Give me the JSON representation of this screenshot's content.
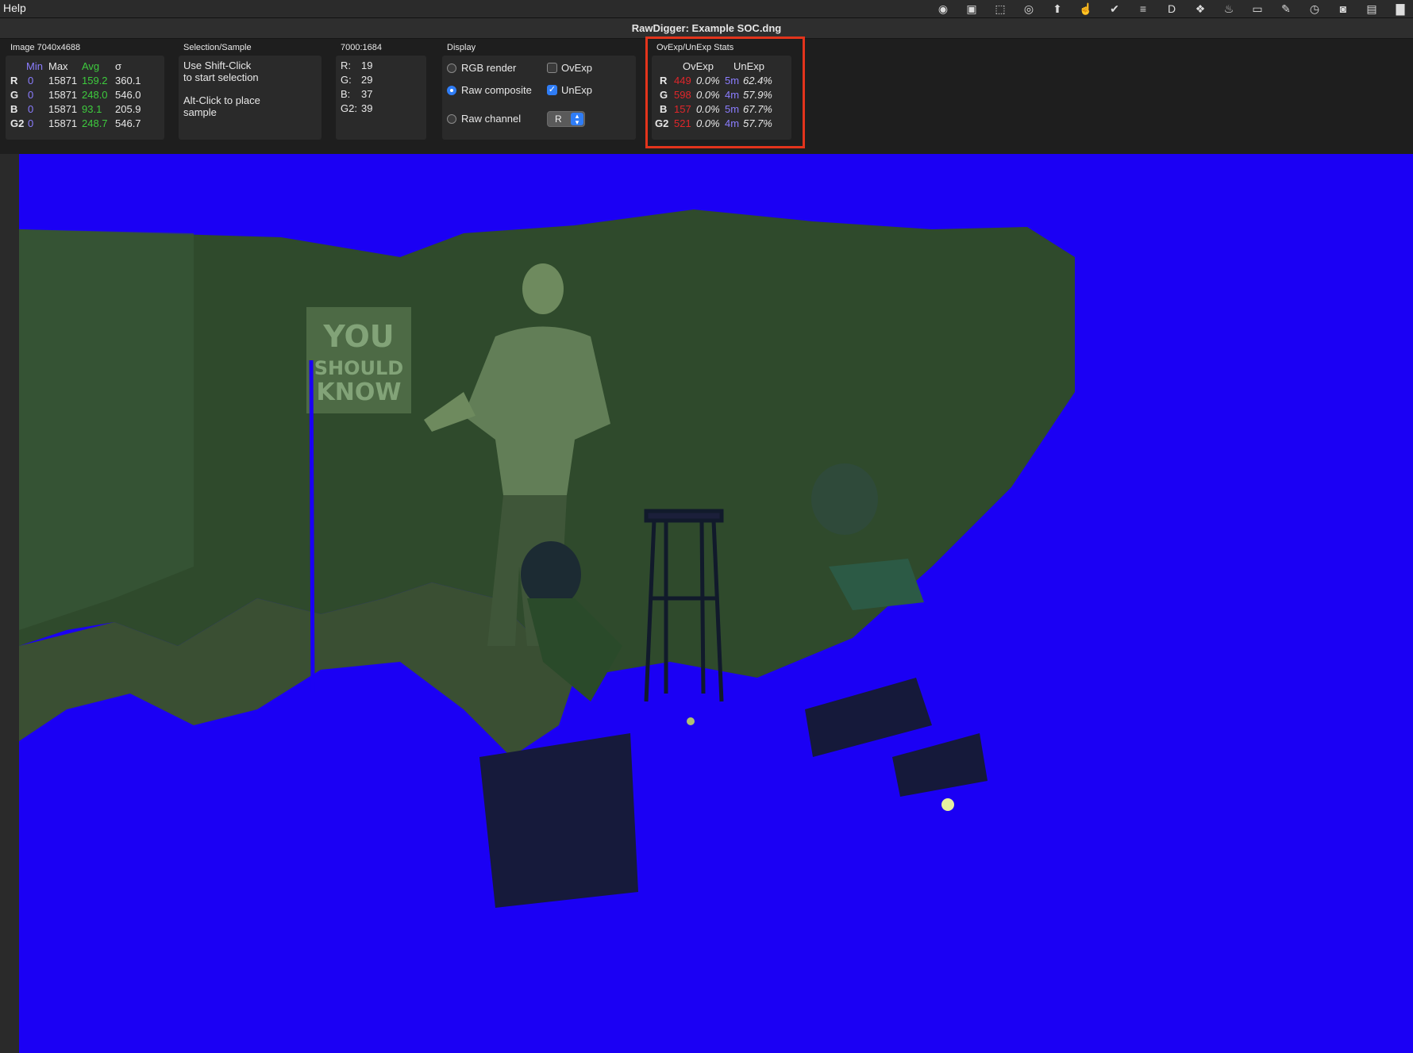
{
  "menubar": {
    "help_label": "Help",
    "extras": [
      {
        "icon": "creative-cloud-icon",
        "glyph": "◉"
      },
      {
        "icon": "cloud-app-icon",
        "glyph": "▣"
      },
      {
        "icon": "screenshot-app-icon",
        "glyph": "⬚"
      },
      {
        "icon": "adobe-creative-cloud-icon",
        "glyph": "◎"
      },
      {
        "icon": "transmit-icon",
        "glyph": "⬆"
      },
      {
        "icon": "gesture-app-icon",
        "glyph": "☝"
      },
      {
        "icon": "task-checkmark-icon",
        "glyph": "✔"
      },
      {
        "icon": "stack-app-icon",
        "glyph": "≡"
      },
      {
        "icon": "d-app-icon",
        "glyph": "D"
      },
      {
        "icon": "dropbox-icon",
        "glyph": "❖"
      },
      {
        "icon": "flame-icon",
        "glyph": "♨"
      },
      {
        "icon": "toggle-icon",
        "glyph": "▭"
      },
      {
        "icon": "pencil-icon",
        "glyph": "✎"
      },
      {
        "icon": "clock-icon",
        "glyph": "◷"
      },
      {
        "icon": "cup-icon",
        "glyph": "◙"
      },
      {
        "icon": "display-icon",
        "glyph": "▤"
      },
      {
        "icon": "battery-icon",
        "glyph": "▇"
      }
    ]
  },
  "window": {
    "title": "RawDigger: Example SOC.dng"
  },
  "image_stats": {
    "title": "Image 7040x4688",
    "headers": [
      "Min",
      "Max",
      "Avg",
      "σ"
    ],
    "rows": [
      {
        "channel": "R",
        "min": "0",
        "max": "15871",
        "avg": "159.2",
        "sigma": "360.1"
      },
      {
        "channel": "G",
        "min": "0",
        "max": "15871",
        "avg": "248.0",
        "sigma": "546.0"
      },
      {
        "channel": "B",
        "min": "0",
        "max": "15871",
        "avg": "93.1",
        "sigma": "205.9"
      },
      {
        "channel": "G2",
        "min": "0",
        "max": "15871",
        "avg": "248.7",
        "sigma": "546.7"
      }
    ]
  },
  "selection": {
    "title": "Selection/Sample",
    "line1": "Use Shift-Click",
    "line2": "to start selection",
    "line3": "Alt-Click to place",
    "line4": "sample"
  },
  "pixel": {
    "title": "7000:1684",
    "rows": [
      {
        "label": "R:",
        "value": "19"
      },
      {
        "label": "G:",
        "value": "29"
      },
      {
        "label": "B:",
        "value": "37"
      },
      {
        "label": "G2:",
        "value": "39"
      }
    ]
  },
  "display": {
    "title": "Display",
    "rgb_render": "RGB render",
    "raw_composite": "Raw composite",
    "raw_channel": "Raw channel",
    "ovexp": "OvExp",
    "unexp": "UnExp",
    "channel_value": "R",
    "selected_mode": "Raw composite",
    "ovexp_checked": false,
    "unexp_checked": true
  },
  "ovexp_stats": {
    "title": "OvExp/UnExp Stats",
    "col_ovexp": "OvExp",
    "col_unexp": "UnExp",
    "rows": [
      {
        "channel": "R",
        "ov_count": "449",
        "ov_pct": "0.0%",
        "un_count": "5m",
        "un_pct": "62.4%"
      },
      {
        "channel": "G",
        "ov_count": "598",
        "ov_pct": "0.0%",
        "un_count": "4m",
        "un_pct": "57.9%"
      },
      {
        "channel": "B",
        "ov_count": "157",
        "ov_pct": "0.0%",
        "un_count": "5m",
        "un_pct": "67.7%"
      },
      {
        "channel": "G2",
        "ov_count": "521",
        "ov_pct": "0.0%",
        "un_count": "4m",
        "un_pct": "57.7%"
      }
    ]
  },
  "image_view": {
    "underexposure_color": "#1b00f4",
    "scene_color": "#3c5a38",
    "poster_text": [
      "YOU",
      "SHOULD",
      "KNOW"
    ]
  }
}
